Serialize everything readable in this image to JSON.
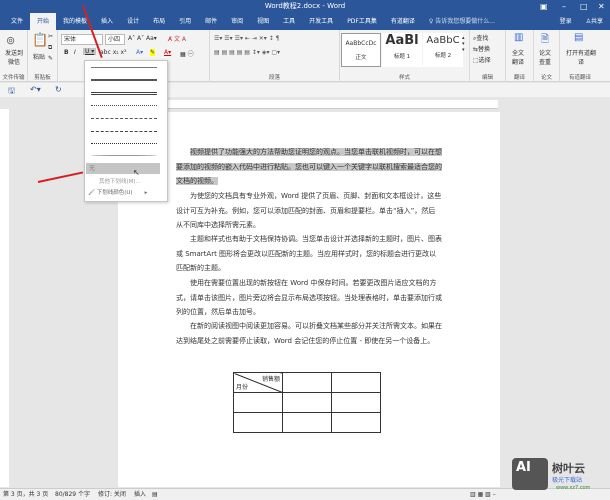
{
  "window": {
    "title": "Word教程2.docx - Word"
  },
  "tabs": [
    "文件",
    "开始",
    "我的模板",
    "插入",
    "设计",
    "布局",
    "引用",
    "邮件",
    "审阅",
    "视图",
    "工具",
    "开发工具",
    "PDF工具集",
    "有道翻译"
  ],
  "tell_me": "告诉我您想要做什么...",
  "account": {
    "login": "登录",
    "share": "共享"
  },
  "ribbon": {
    "send": "发送到微信",
    "paste": "粘贴",
    "font_name": "宋体",
    "font_size": "小四",
    "groups": [
      "文件传输",
      "剪贴板",
      "段落",
      "样式",
      "编辑",
      "翻译",
      "论文",
      "有道翻译"
    ],
    "styles": [
      {
        "preview": "AaBbCcDc",
        "name": "正文"
      },
      {
        "preview": "AaBl",
        "name": "标题 1"
      },
      {
        "preview": "AaBbC",
        "name": "标题 2"
      }
    ],
    "edit": [
      "查找",
      "替换",
      "选择"
    ],
    "fulltext": "全文翻译",
    "paper": "论文查重",
    "open_youdao": "打开有道翻译"
  },
  "underline_menu": {
    "none": "无",
    "more": "其他下划线(M)...",
    "color": "下划线颜色(U)"
  },
  "document": {
    "paragraphs": [
      "视频提供了功能强大的方法帮助您证明您的观点。当您单击联机视频时，可以在想要添加的视频的嵌入代码中进行粘贴。您也可以键入一个关键字以联机搜索最适合您的文档的视频。",
      "为使您的文档具有专业外观，Word 提供了页眉、页脚、封面和文本框设计，这些设计可互为补充。例如，您可以添加匹配的封面、页眉和提要栏。单击“插入”，然后从不同库中选择所需元素。",
      "主题和样式也有助于文档保持协调。当您单击设计并选择新的主题时，图片、图表或 SmartArt 图形将会更改以匹配新的主题。当应用样式时，您的标题会进行更改以匹配新的主题。",
      "使用在需要位置出现的新按钮在 Word 中保存时间。若要更改图片适应文档的方式，请单击该图片，图片旁边将会显示布局选项按钮。当处理表格时，单击要添加行或列的位置，然后单击加号。",
      "在新的阅读视图中阅读更加容易。可以折叠文档某些部分并关注所需文本。如果在达到结尾处之前需要停止读取，Word 会记住您的停止位置 - 即使在另一个设备上。"
    ],
    "table": {
      "header_top": "销售额",
      "header_bottom": "月份"
    }
  },
  "status": {
    "page": "第 3 页，共 3 页",
    "words": "80/829 个字",
    "revision": "修订: 关闭",
    "mode": "插入"
  },
  "watermark": {
    "brand": "树叶云",
    "sub": "极光下载站",
    "url": "www.xz7.com"
  }
}
